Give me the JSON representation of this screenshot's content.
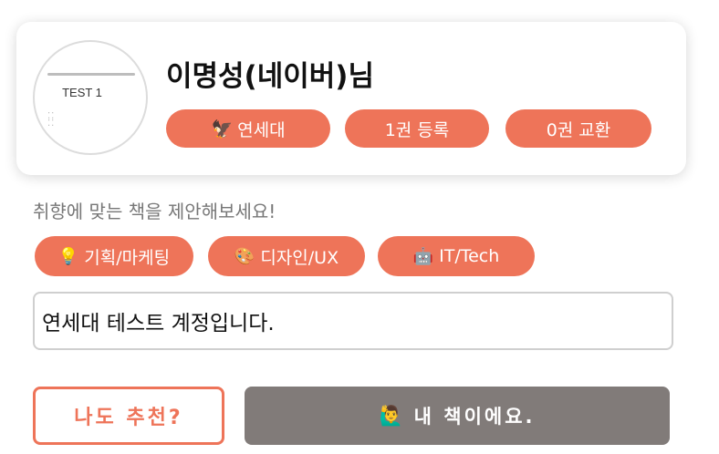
{
  "profile": {
    "avatar_text": "TEST 1",
    "name": "이명성(네이버)님",
    "badges": [
      {
        "icon": "eagle-icon",
        "emoji": "🦅",
        "label": "연세대"
      },
      {
        "label": "1권 등록"
      },
      {
        "label": "0권 교환"
      }
    ]
  },
  "suggest": {
    "text": "취향에 맞는 책을 제안해보세요!",
    "tags": [
      {
        "icon": "lightbulb-icon",
        "emoji": "💡",
        "label": "기획/마케팅"
      },
      {
        "icon": "palette-icon",
        "emoji": "🎨",
        "label": "디자인/UX"
      },
      {
        "icon": "robot-icon",
        "emoji": "🤖",
        "label": "IT/Tech"
      }
    ]
  },
  "message": {
    "value": "연세대 테스트 계정입니다."
  },
  "actions": {
    "recommend_label": "나도 추천?",
    "mybook_icon": "raising-hand-icon",
    "mybook_emoji": "🙋‍♂️",
    "mybook_label": "내 책이에요."
  },
  "colors": {
    "accent": "#ee7459",
    "button_gray": "#817b79",
    "border": "#cfcfcf",
    "muted_text": "#777777"
  }
}
